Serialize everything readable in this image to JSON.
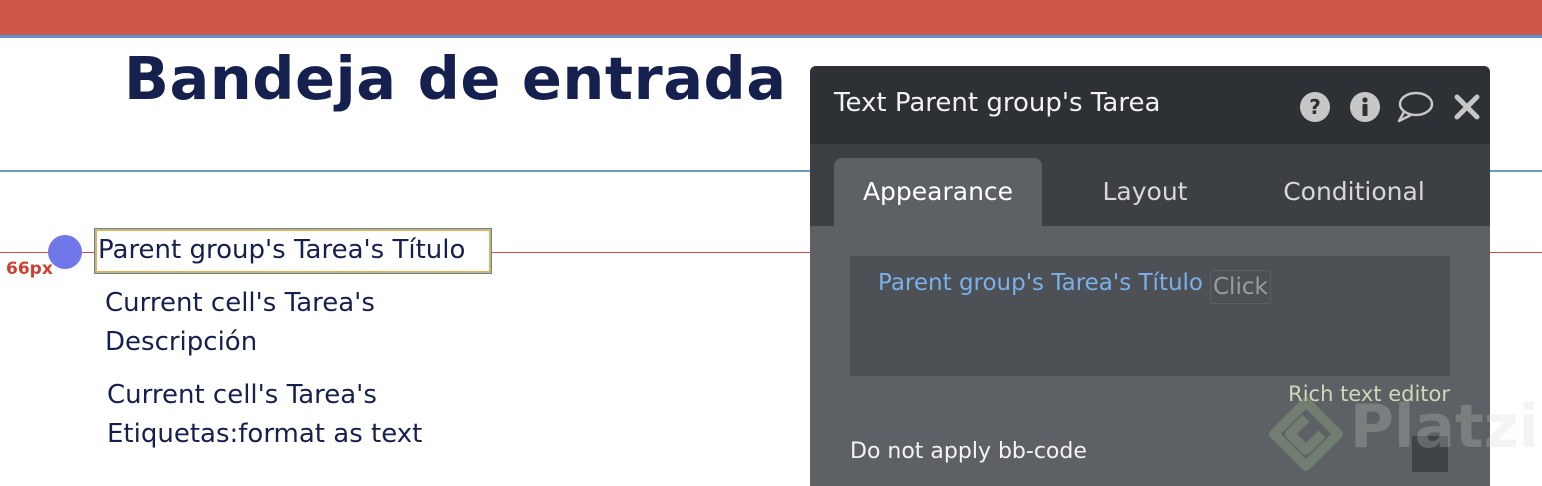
{
  "page": {
    "title": "Bandeja de entrada",
    "measure_label": "66px"
  },
  "canvas": {
    "selected_text": "Parent group's Tarea's Título",
    "description_lines": [
      "Current cell's Tarea's",
      "Descripción"
    ],
    "tags_lines": [
      "Current cell's Tarea's",
      "Etiquetas:format as text"
    ]
  },
  "property_panel": {
    "title": "Text Parent group's Tarea",
    "icons": [
      "help-icon",
      "info-icon",
      "comment-icon",
      "close-icon"
    ],
    "tabs": [
      {
        "label": "Appearance",
        "active": true
      },
      {
        "label": "Layout",
        "active": false
      },
      {
        "label": "Conditional",
        "active": false
      }
    ],
    "content": {
      "expression": "Parent group's Tarea's Título",
      "click_label": "Click"
    },
    "rich_text_label": "Rich text editor",
    "bbcode_label": "Do not apply bb-code"
  },
  "watermark": {
    "text": "Platzi"
  },
  "colors": {
    "top_bar": "#cd5649",
    "title_text": "#16204f",
    "panel_header": "#2d3034",
    "panel_body": "#5d6064",
    "dynamic_expression": "#7ab1ea",
    "handle_dot": "#7077e8"
  }
}
